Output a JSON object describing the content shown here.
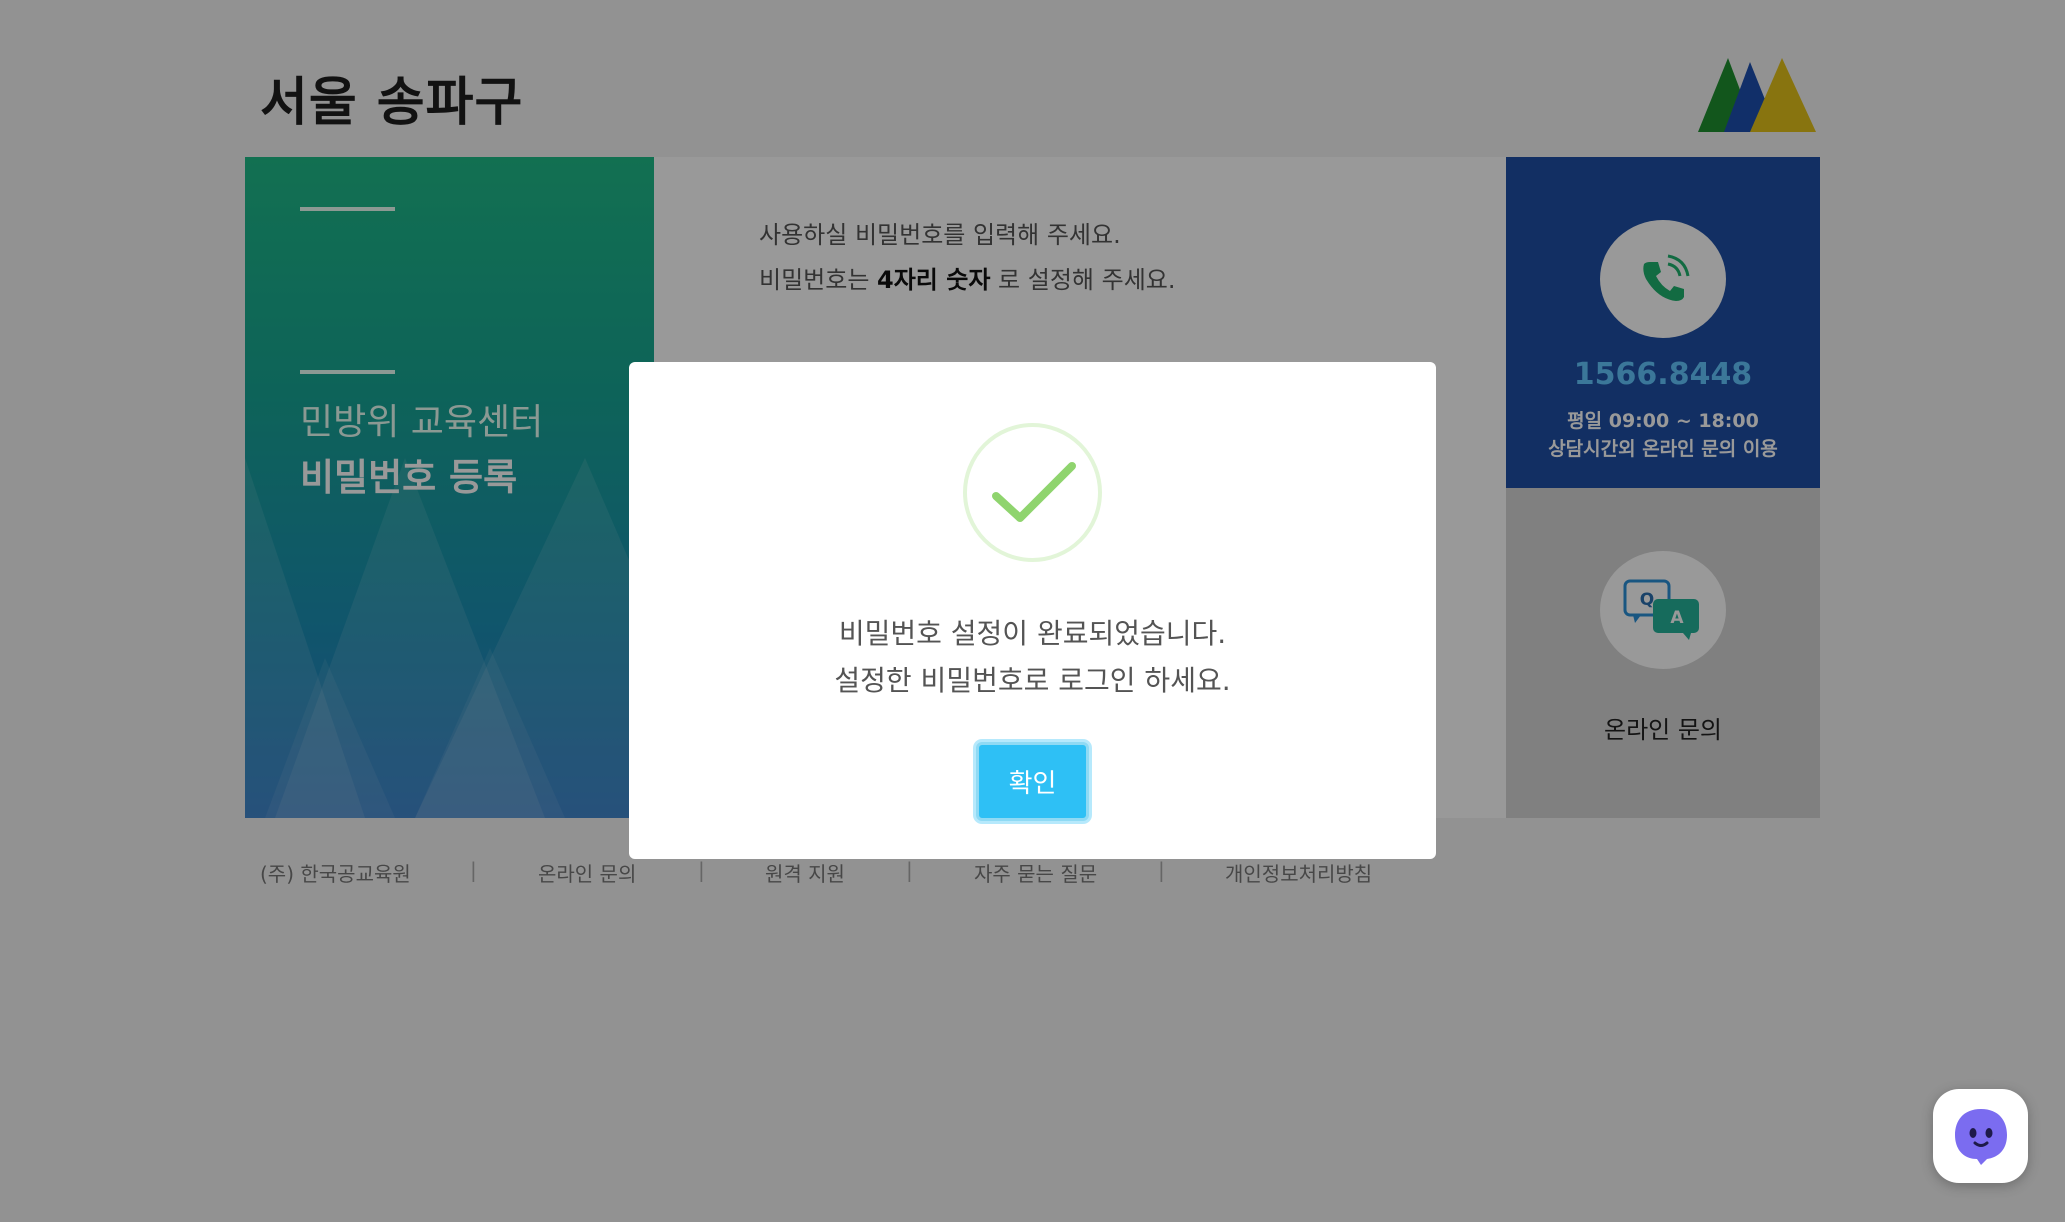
{
  "header": {
    "title": "서울 송파구"
  },
  "left_panel": {
    "subtitle": "민방위 교육센터",
    "heading": "비밀번호 등록"
  },
  "center_panel": {
    "guide_line1": "사용하실 비밀번호를 입력해 주세요.",
    "guide_line2_prefix": "비밀번호는 ",
    "guide_line2_emph": "4자리 숫자",
    "guide_line2_suffix": " 로 설정해 주세요."
  },
  "contact": {
    "phone": "1566.8448",
    "hours": "평일 09:00 ~ 18:00",
    "hours_note": "상담시간외 온라인 문의 이용",
    "online_label": "온라인 문의",
    "qa_q": "Q",
    "qa_a": "A"
  },
  "footer": {
    "company": "(주) 한국공교육원",
    "online": "온라인 문의",
    "remote": "원격 지원",
    "faq": "자주 묻는 질문",
    "privacy": "개인정보처리방침",
    "separator": "|"
  },
  "modal": {
    "message_line1": "비밀번호 설정이 완료되었습니다.",
    "message_line2": "설정한 비밀번호로 로그인 하세요.",
    "confirm_label": "확인"
  },
  "colors": {
    "accent": "#2ec0f5",
    "contact_blue": "#1f4fa5",
    "check_green": "#8fd46e"
  },
  "icons": [
    "logo-icon",
    "phone-icon",
    "qa-icon",
    "check-icon",
    "chatbot-icon"
  ]
}
